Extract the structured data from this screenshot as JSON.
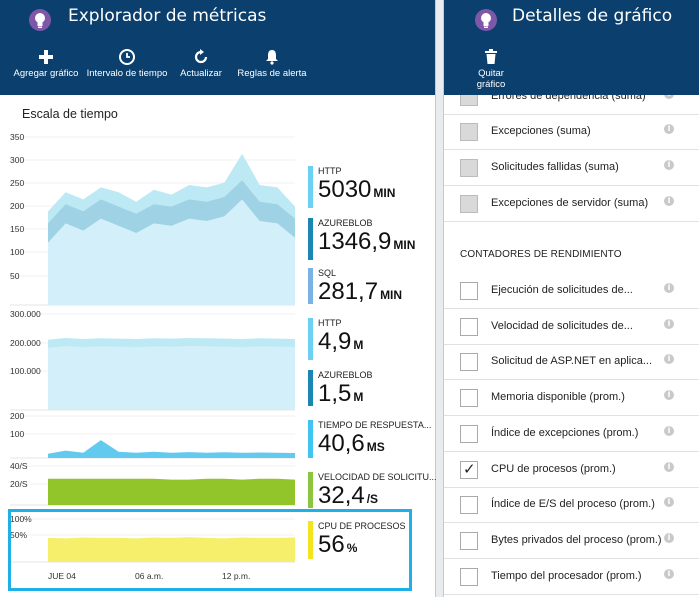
{
  "left": {
    "title": "Explorador de métricas",
    "toolbar": {
      "add_chart": "Agregar gráfico",
      "time_range": "Intervalo de tiempo",
      "refresh": "Actualizar",
      "alert_rules": "Reglas de alerta"
    },
    "section_label": "Escala de tiempo",
    "chart_data": [
      {
        "type": "area",
        "title": "",
        "y_ticks": [
          "350",
          "300",
          "250",
          "200",
          "150",
          "100",
          "50"
        ],
        "ylim": [
          0,
          350
        ],
        "series": [
          {
            "name": "HTTP",
            "values": [
              195,
              235,
              220,
              245,
              235,
              215,
              240,
              230,
              250,
              245,
              255,
              315,
              250,
              245,
              205
            ]
          },
          {
            "name": "AZUREBLOB",
            "values": [
              170,
              210,
              195,
              220,
              205,
              190,
              210,
              205,
              220,
              215,
              225,
              260,
              215,
              210,
              180
            ]
          }
        ],
        "color_outer": "#bde9f5",
        "color_inner": "#9ccfe3"
      },
      {
        "type": "area",
        "title": "",
        "y_ticks": [
          "300.000",
          "200.000",
          "100.000"
        ],
        "ylim": [
          0,
          300000
        ],
        "series": [
          {
            "name": "HTTP",
            "values": [
              220000,
              225000,
              222000,
              224000,
              223000,
              222000,
              224000,
              223000,
              225000,
              224000,
              223000,
              222000,
              224000,
              223000,
              222000
            ]
          }
        ],
        "color_outer": "#bde9f5",
        "color_inner": "#a9d8ea"
      },
      {
        "type": "area",
        "title": "",
        "y_ticks": [
          "200",
          "100"
        ],
        "ylim": [
          0,
          200
        ],
        "series": [
          {
            "name": "TIEMPO DE RESPUESTA",
            "values": [
              20,
              35,
              25,
              85,
              30,
              25,
              30,
              25,
              28,
              25,
              27,
              25,
              26,
              25,
              24
            ]
          }
        ],
        "color_outer": "#62c9ef"
      },
      {
        "type": "area",
        "title": "",
        "y_ticks": [
          "40/S",
          "20/S"
        ],
        "ylim": [
          0,
          40
        ],
        "series": [
          {
            "name": "VELOCIDAD DE SOLICITUD",
            "values": [
              27,
              27,
              27,
              27,
              27,
              27,
              27,
              26,
              26,
              27,
              27,
              26,
              27,
              27,
              26
            ]
          }
        ],
        "color_outer": "#92c52a"
      },
      {
        "type": "area",
        "title": "",
        "y_ticks": [
          "100%",
          "50%"
        ],
        "ylim": [
          0,
          100
        ],
        "series": [
          {
            "name": "CPU DE PROCESOS",
            "values": [
              56,
              55,
              57,
              56,
              56,
              55,
              57,
              56,
              58,
              56,
              55,
              57,
              56,
              56,
              57
            ]
          }
        ],
        "color_outer": "#f5ef6b"
      }
    ],
    "x_ticks": [
      "JUE 04",
      "06 a.m.",
      "12 p.m."
    ],
    "metrics": [
      {
        "name": "HTTP",
        "value": "5030",
        "unit": "MIN",
        "color": "#6cd0f2"
      },
      {
        "name": "AZUREBLOB",
        "value": "1346,9",
        "unit": "MIN",
        "color": "#1a86b4"
      },
      {
        "name": "SQL",
        "value": "281,7",
        "unit": "MIN",
        "color": "#79b2e3"
      },
      {
        "name": "HTTP",
        "value": "4,9",
        "unit": "M",
        "color": "#6cd0f2"
      },
      {
        "name": "AZUREBLOB",
        "value": "1,5",
        "unit": "M",
        "color": "#1a86b4"
      },
      {
        "name": "TIEMPO DE RESPUESTA...",
        "value": "40,6",
        "unit": "MS",
        "color": "#40c4f1"
      },
      {
        "name": "VELOCIDAD DE SOLICITU...",
        "value": "32,4",
        "unit": "/S",
        "color": "#8cc63f"
      },
      {
        "name": "CPU DE PROCESOS",
        "value": "56",
        "unit": "%",
        "color": "#f2e51e"
      }
    ]
  },
  "right": {
    "title": "Detalles de gráfico",
    "toolbar": {
      "remove_chart": "Quitar gráfico"
    },
    "items_top": [
      {
        "label": "Errores de dependencia (suma)",
        "checked": false,
        "grey": true
      },
      {
        "label": "Excepciones (suma)",
        "checked": false,
        "grey": true
      },
      {
        "label": "Solicitudes fallidas (suma)",
        "checked": false,
        "grey": true
      },
      {
        "label": "Excepciones de servidor (suma)",
        "checked": false,
        "grey": true
      }
    ],
    "section_perf": "CONTADORES DE RENDIMIENTO",
    "items_perf": [
      {
        "label": "Ejecución de solicitudes de...",
        "checked": false
      },
      {
        "label": "Velocidad de solicitudes de...",
        "checked": false
      },
      {
        "label": "Solicitud de ASP.NET en aplica...",
        "checked": false
      },
      {
        "label": "Memoria disponible (prom.)",
        "checked": false
      },
      {
        "label": "Índice de excepciones (prom.)",
        "checked": false
      },
      {
        "label": "CPU de procesos (prom.)",
        "checked": true
      },
      {
        "label": "Índice de E/S del proceso (prom.)",
        "checked": false
      },
      {
        "label": "Bytes privados del proceso (prom.)",
        "checked": false
      },
      {
        "label": "Tiempo del procesador (prom.)",
        "checked": false
      }
    ],
    "info_glyph": "i"
  }
}
